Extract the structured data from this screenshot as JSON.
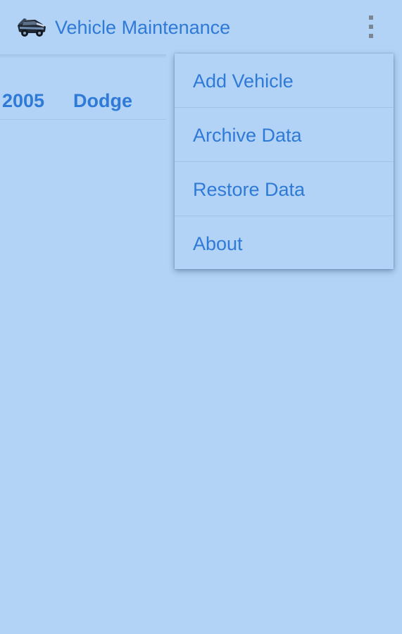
{
  "app": {
    "title": "Vehicle Maintenance",
    "icon": "car-icon"
  },
  "toolbar": {
    "overflow_icon": "more-vert-icon"
  },
  "vehicles": [
    {
      "year": "2005",
      "make": "Dodge"
    }
  ],
  "menu": {
    "items": [
      {
        "label": "Add Vehicle"
      },
      {
        "label": "Archive Data"
      },
      {
        "label": "Restore Data"
      },
      {
        "label": "About"
      }
    ]
  },
  "colors": {
    "background": "#b2d3f5",
    "accent_text": "#2f7ad6",
    "overflow_dots": "#7a8693"
  }
}
